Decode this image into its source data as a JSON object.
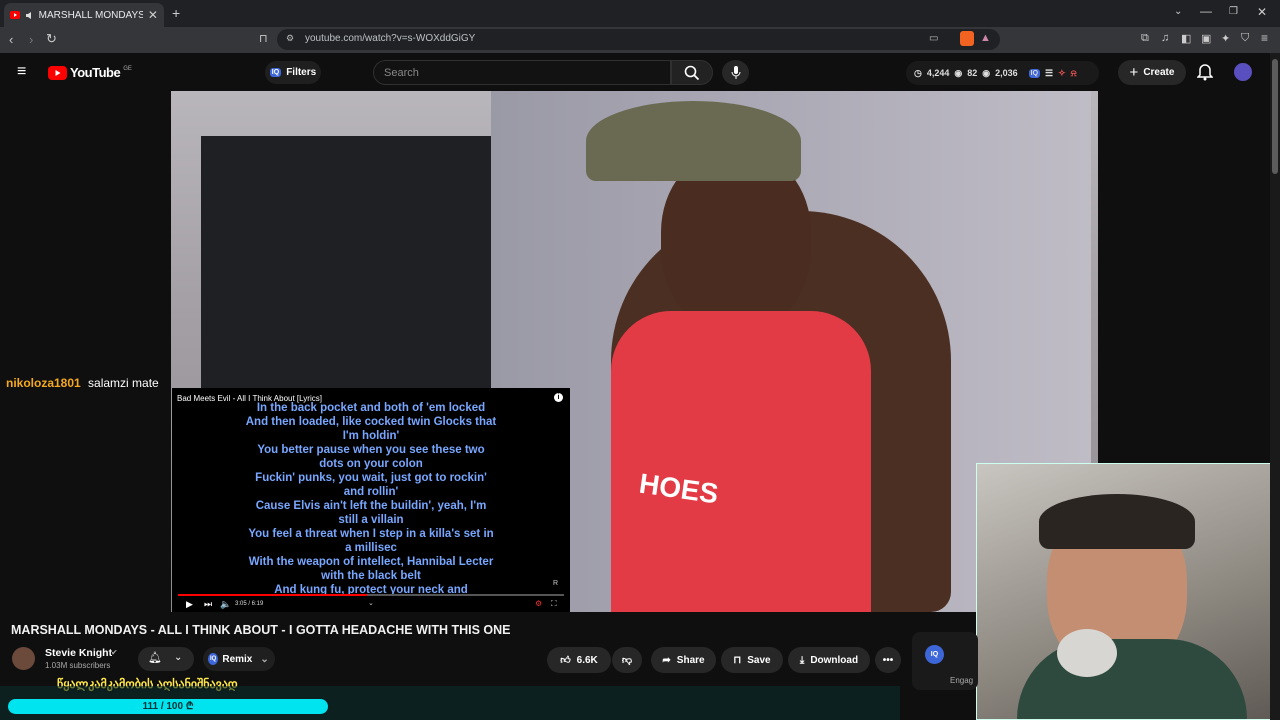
{
  "browser": {
    "tab_title": "MARSHALL MONDAYS - ALL",
    "url": "youtube.com/watch?v=s-WOXddGiGY"
  },
  "youtube": {
    "logo_text": "YouTube",
    "country_code": "GE",
    "filters_label": "Filters",
    "search_placeholder": "Search",
    "stats": {
      "views": "4,244",
      "watching": "82",
      "viewers": "2,036"
    },
    "create_label": "Create"
  },
  "chat": {
    "user": "nikoloza1801",
    "message": "salamzi mate"
  },
  "pip": {
    "title": "Bad Meets Evil - All I Think About [Lyrics]",
    "time": "3:05 / 6:19",
    "lyrics": [
      "In the back pocket and both of  'em locked",
      "And then loaded, like cocked twin Glocks that",
      "I'm holdin'",
      "You better pause when you see these two",
      "dots on your colon",
      "Fuckin' punks, you wait, just got to rockin'",
      "and rollin'",
      "Cause Elvis ain't left the buildin', yeah, I'm",
      "still a villain",
      "You feel a threat when I step in a killa's set in",
      "a millisec",
      "With the weapon of intellect, Hannibal Lecter",
      "with the black belt",
      "And kung fu, protect your neck and"
    ],
    "progress": 0.49
  },
  "video": {
    "title": "MARSHALL MONDAYS - ALL I THINK ABOUT - I GOTTA HEADACHE WITH THIS ONE",
    "channel": "Stevie Knight",
    "subscribers": "1.03M subscribers",
    "remix_label": "Remix",
    "likes": "6.6K",
    "share_label": "Share",
    "save_label": "Save",
    "download_label": "Download",
    "engage_label": "Engag",
    "shirt_text": "HOES"
  },
  "overlay": {
    "georgian_text": "წყალკამკამობის აღსანიშნავად",
    "goal_progress": "111 / 100 ₾"
  },
  "colors": {
    "youtube_red": "#ff0000",
    "chat_user": "#f4a91f",
    "lyrics": "#78a7ff",
    "goal": "#00e4f0"
  }
}
